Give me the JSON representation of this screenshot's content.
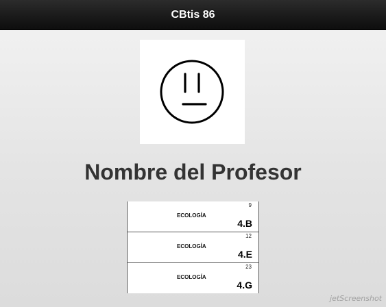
{
  "header": {
    "title": "CBtis 86"
  },
  "profile": {
    "avatar_icon": "neutral-face-icon",
    "name": "Nombre del Profesor"
  },
  "classes": [
    {
      "subject": "ECOLOGÍA",
      "count": "9",
      "group": "4.B"
    },
    {
      "subject": "ECOLOGÍA",
      "count": "12",
      "group": "4.E"
    },
    {
      "subject": "ECOLOGÍA",
      "count": "23",
      "group": "4.G"
    }
  ],
  "watermark": "jetScreenshot"
}
